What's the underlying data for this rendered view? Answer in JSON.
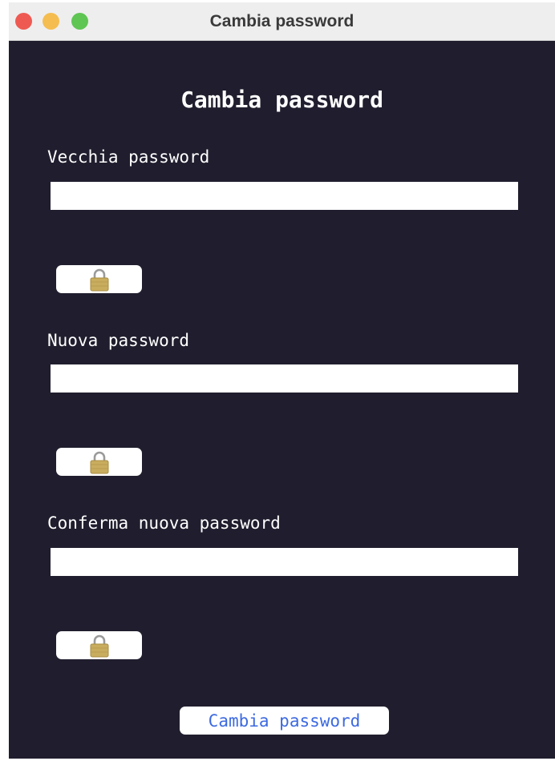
{
  "window": {
    "title": "Cambia password"
  },
  "form": {
    "heading": "Cambia password",
    "fields": [
      {
        "label": "Vecchia password",
        "value": "",
        "toggle_icon": "lock-icon"
      },
      {
        "label": "Nuova password",
        "value": "",
        "toggle_icon": "lock-icon"
      },
      {
        "label": "Conferma nuova password",
        "value": "",
        "toggle_icon": "lock-icon"
      }
    ],
    "submit_label": "Cambia password"
  },
  "colors": {
    "background": "#201e2e",
    "text": "#ffffff",
    "submit_text": "#3d6ae0",
    "traffic_close": "#ee5a52",
    "traffic_minimize": "#f5bd4f",
    "traffic_maximize": "#5fc553"
  }
}
